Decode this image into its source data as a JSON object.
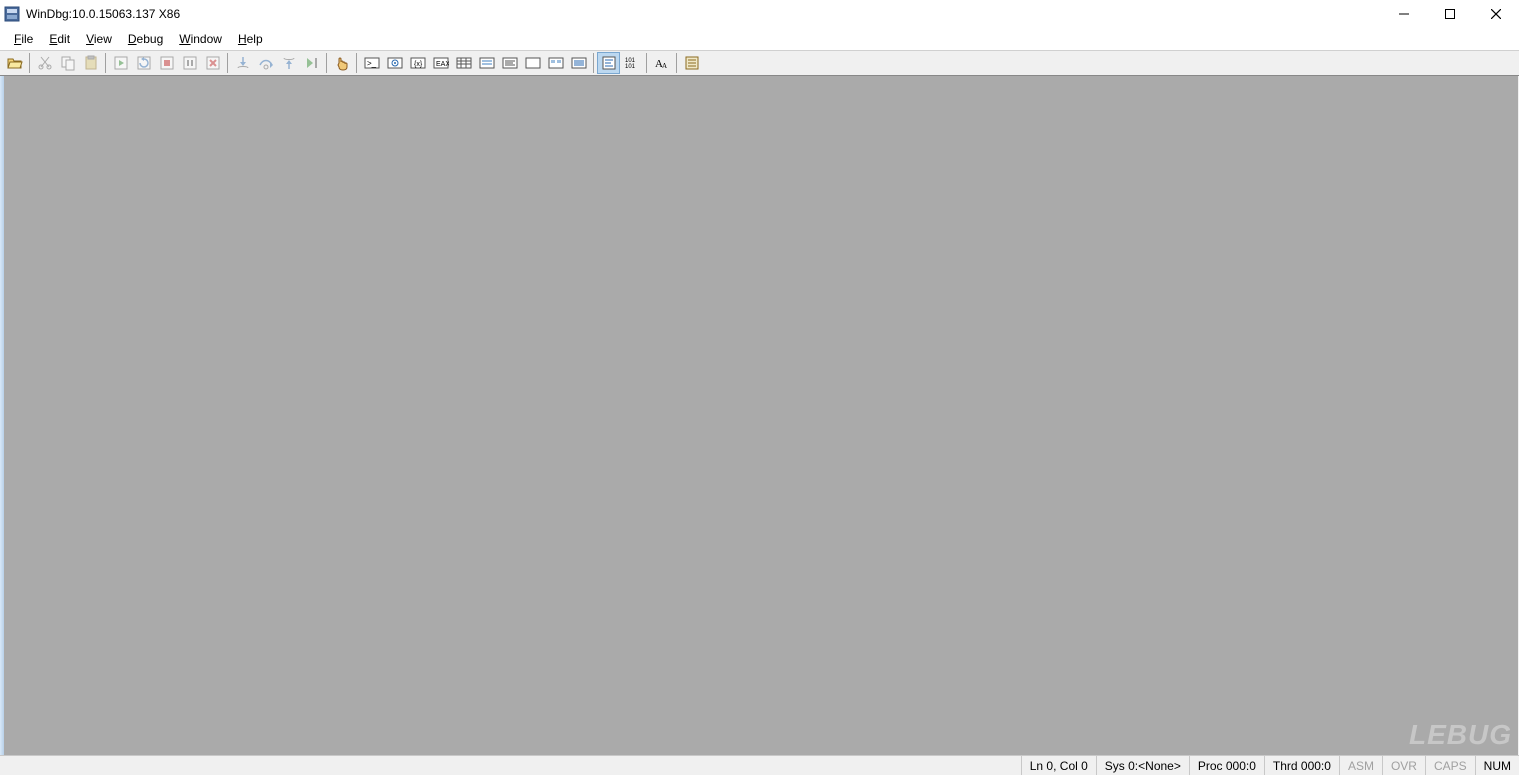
{
  "window": {
    "title": "WinDbg:10.0.15063.137 X86"
  },
  "menu": {
    "items": [
      "File",
      "Edit",
      "View",
      "Debug",
      "Window",
      "Help"
    ]
  },
  "toolbar": {
    "groups": [
      {
        "buttons": [
          {
            "name": "open-icon",
            "enabled": true
          }
        ]
      },
      {
        "buttons": [
          {
            "name": "cut-icon",
            "enabled": false
          },
          {
            "name": "copy-icon",
            "enabled": false
          },
          {
            "name": "paste-icon",
            "enabled": false
          }
        ]
      },
      {
        "buttons": [
          {
            "name": "go-icon",
            "enabled": false
          },
          {
            "name": "restart-icon",
            "enabled": false
          },
          {
            "name": "stop-debug-icon",
            "enabled": false
          },
          {
            "name": "break-icon",
            "enabled": false
          },
          {
            "name": "stop-icon",
            "enabled": false
          }
        ]
      },
      {
        "buttons": [
          {
            "name": "step-into-icon",
            "enabled": false
          },
          {
            "name": "step-over-icon",
            "enabled": false
          },
          {
            "name": "step-out-icon",
            "enabled": false
          },
          {
            "name": "run-to-cursor-icon",
            "enabled": false
          }
        ]
      },
      {
        "buttons": [
          {
            "name": "breakpoint-hand-icon",
            "enabled": true
          }
        ]
      },
      {
        "buttons": [
          {
            "name": "command-window-icon",
            "enabled": true
          },
          {
            "name": "watch-window-icon",
            "enabled": true
          },
          {
            "name": "locals-window-icon",
            "enabled": true
          },
          {
            "name": "registers-window-icon",
            "enabled": true
          },
          {
            "name": "memory-window-icon",
            "enabled": true
          },
          {
            "name": "callstack-window-icon",
            "enabled": true
          },
          {
            "name": "disassembly-window-icon",
            "enabled": true
          },
          {
            "name": "scratchpad-window-icon",
            "enabled": true
          },
          {
            "name": "processes-window-icon",
            "enabled": true
          },
          {
            "name": "threads-window-icon",
            "enabled": true
          }
        ]
      },
      {
        "buttons": [
          {
            "name": "source-mode-icon",
            "enabled": true,
            "active": true
          },
          {
            "name": "binary-mode-icon",
            "enabled": true
          }
        ]
      },
      {
        "buttons": [
          {
            "name": "font-icon",
            "enabled": true
          }
        ]
      },
      {
        "buttons": [
          {
            "name": "options-icon",
            "enabled": true
          }
        ]
      }
    ]
  },
  "status": {
    "ln_col": "Ln 0, Col 0",
    "sys": "Sys 0:<None>",
    "proc": "Proc 000:0",
    "thrd": "Thrd 000:0",
    "asm": "ASM",
    "ovr": "OVR",
    "caps": "CAPS",
    "num": "NUM"
  },
  "watermark": "LEBUG"
}
